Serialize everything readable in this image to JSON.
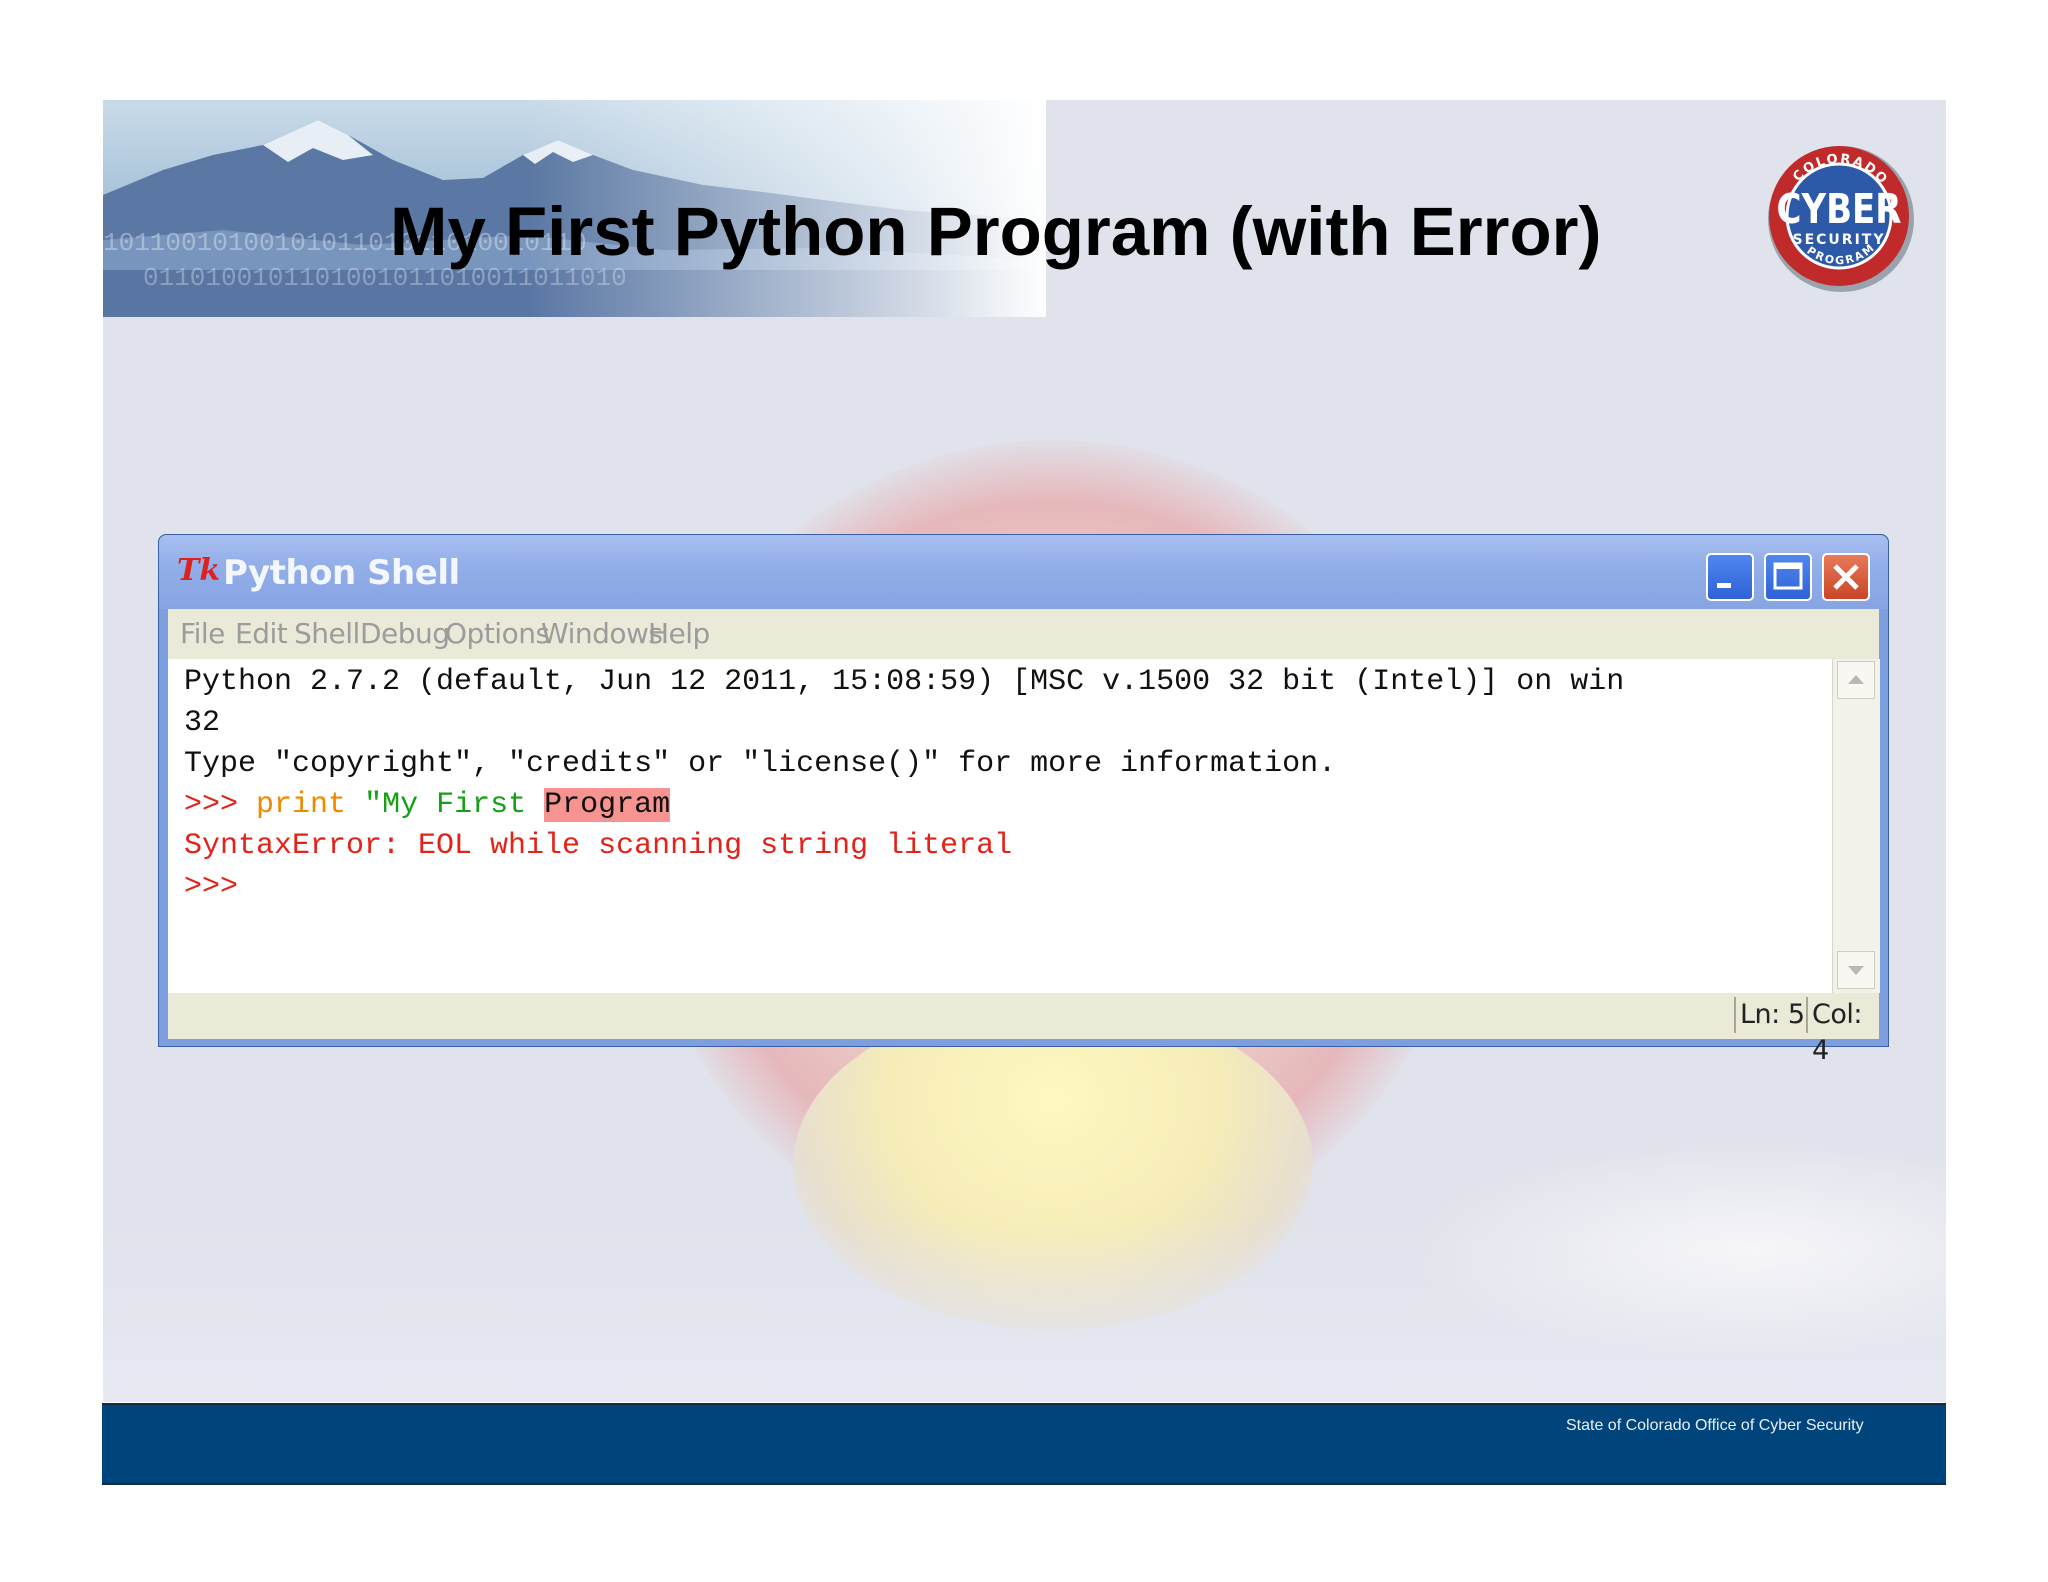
{
  "slide": {
    "title": "My First Python Program (with Error)",
    "footer_text": "State of Colorado Office of Cyber Security"
  },
  "badge": {
    "top_text": "COLORADO",
    "main_text": "CYBER",
    "sub_text": "SECURITY",
    "bottom_text": "PROGRAM"
  },
  "window": {
    "app_icon": "Tk",
    "title": "Python Shell",
    "controls": {
      "minimize": "minimize-icon",
      "maximize": "maximize-icon",
      "close": "close-icon"
    }
  },
  "menu": [
    "File",
    "Edit",
    "Shell",
    "Debug",
    "Options",
    "Windows",
    "Help"
  ],
  "shell": {
    "line1": "Python 2.7.2 (default, Jun 12 2011, 15:08:59) [MSC v.1500 32 bit (Intel)] on win",
    "line2": "32",
    "line3": "Type \"copyright\", \"credits\" or \"license()\" for more information.",
    "prompt": ">>>",
    "keyword": "print",
    "string_part": "\"My First",
    "error_highlight": "Program",
    "error": "SyntaxError: EOL while scanning string literal",
    "prompt2": ">>>"
  },
  "status": {
    "line": "Ln: 5",
    "col": "Col: 4"
  },
  "colors": {
    "footer": "#00447c",
    "prompt": "#e2231a",
    "keyword": "#ef8a00",
    "string": "#16a015",
    "error_highlight": "#f79491",
    "titlebar": "#93afe9"
  }
}
